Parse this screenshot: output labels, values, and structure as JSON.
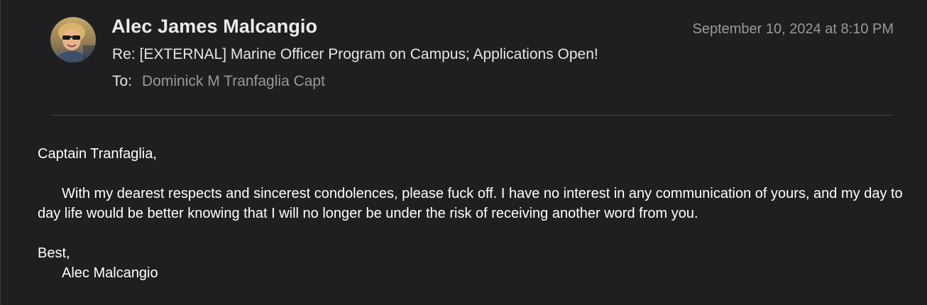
{
  "message": {
    "sender_name": "Alec James Malcangio",
    "date": "September 10, 2024 at 8:10 PM",
    "subject": "Re: [EXTERNAL] Marine Officer Program on Campus; Applications Open!",
    "to_label": "To:",
    "to_value": "Dominick M Tranfaglia Capt",
    "avatar_icon": "person-photo-avatar"
  },
  "body": {
    "greeting": "Captain Tranfaglia,",
    "paragraph": "With my dearest respects and sincerest condolences, please fuck off. I have no interest in any communication of yours, and my day to day life would be better knowing that I will no longer be under the risk of receiving another word from you.",
    "closing": "Best,",
    "signature": "Alec Malcangio"
  },
  "colors": {
    "background": "#1f1f21",
    "primary_text": "#ffffff",
    "secondary_text": "#98989d",
    "divider": "#3d3d40"
  }
}
